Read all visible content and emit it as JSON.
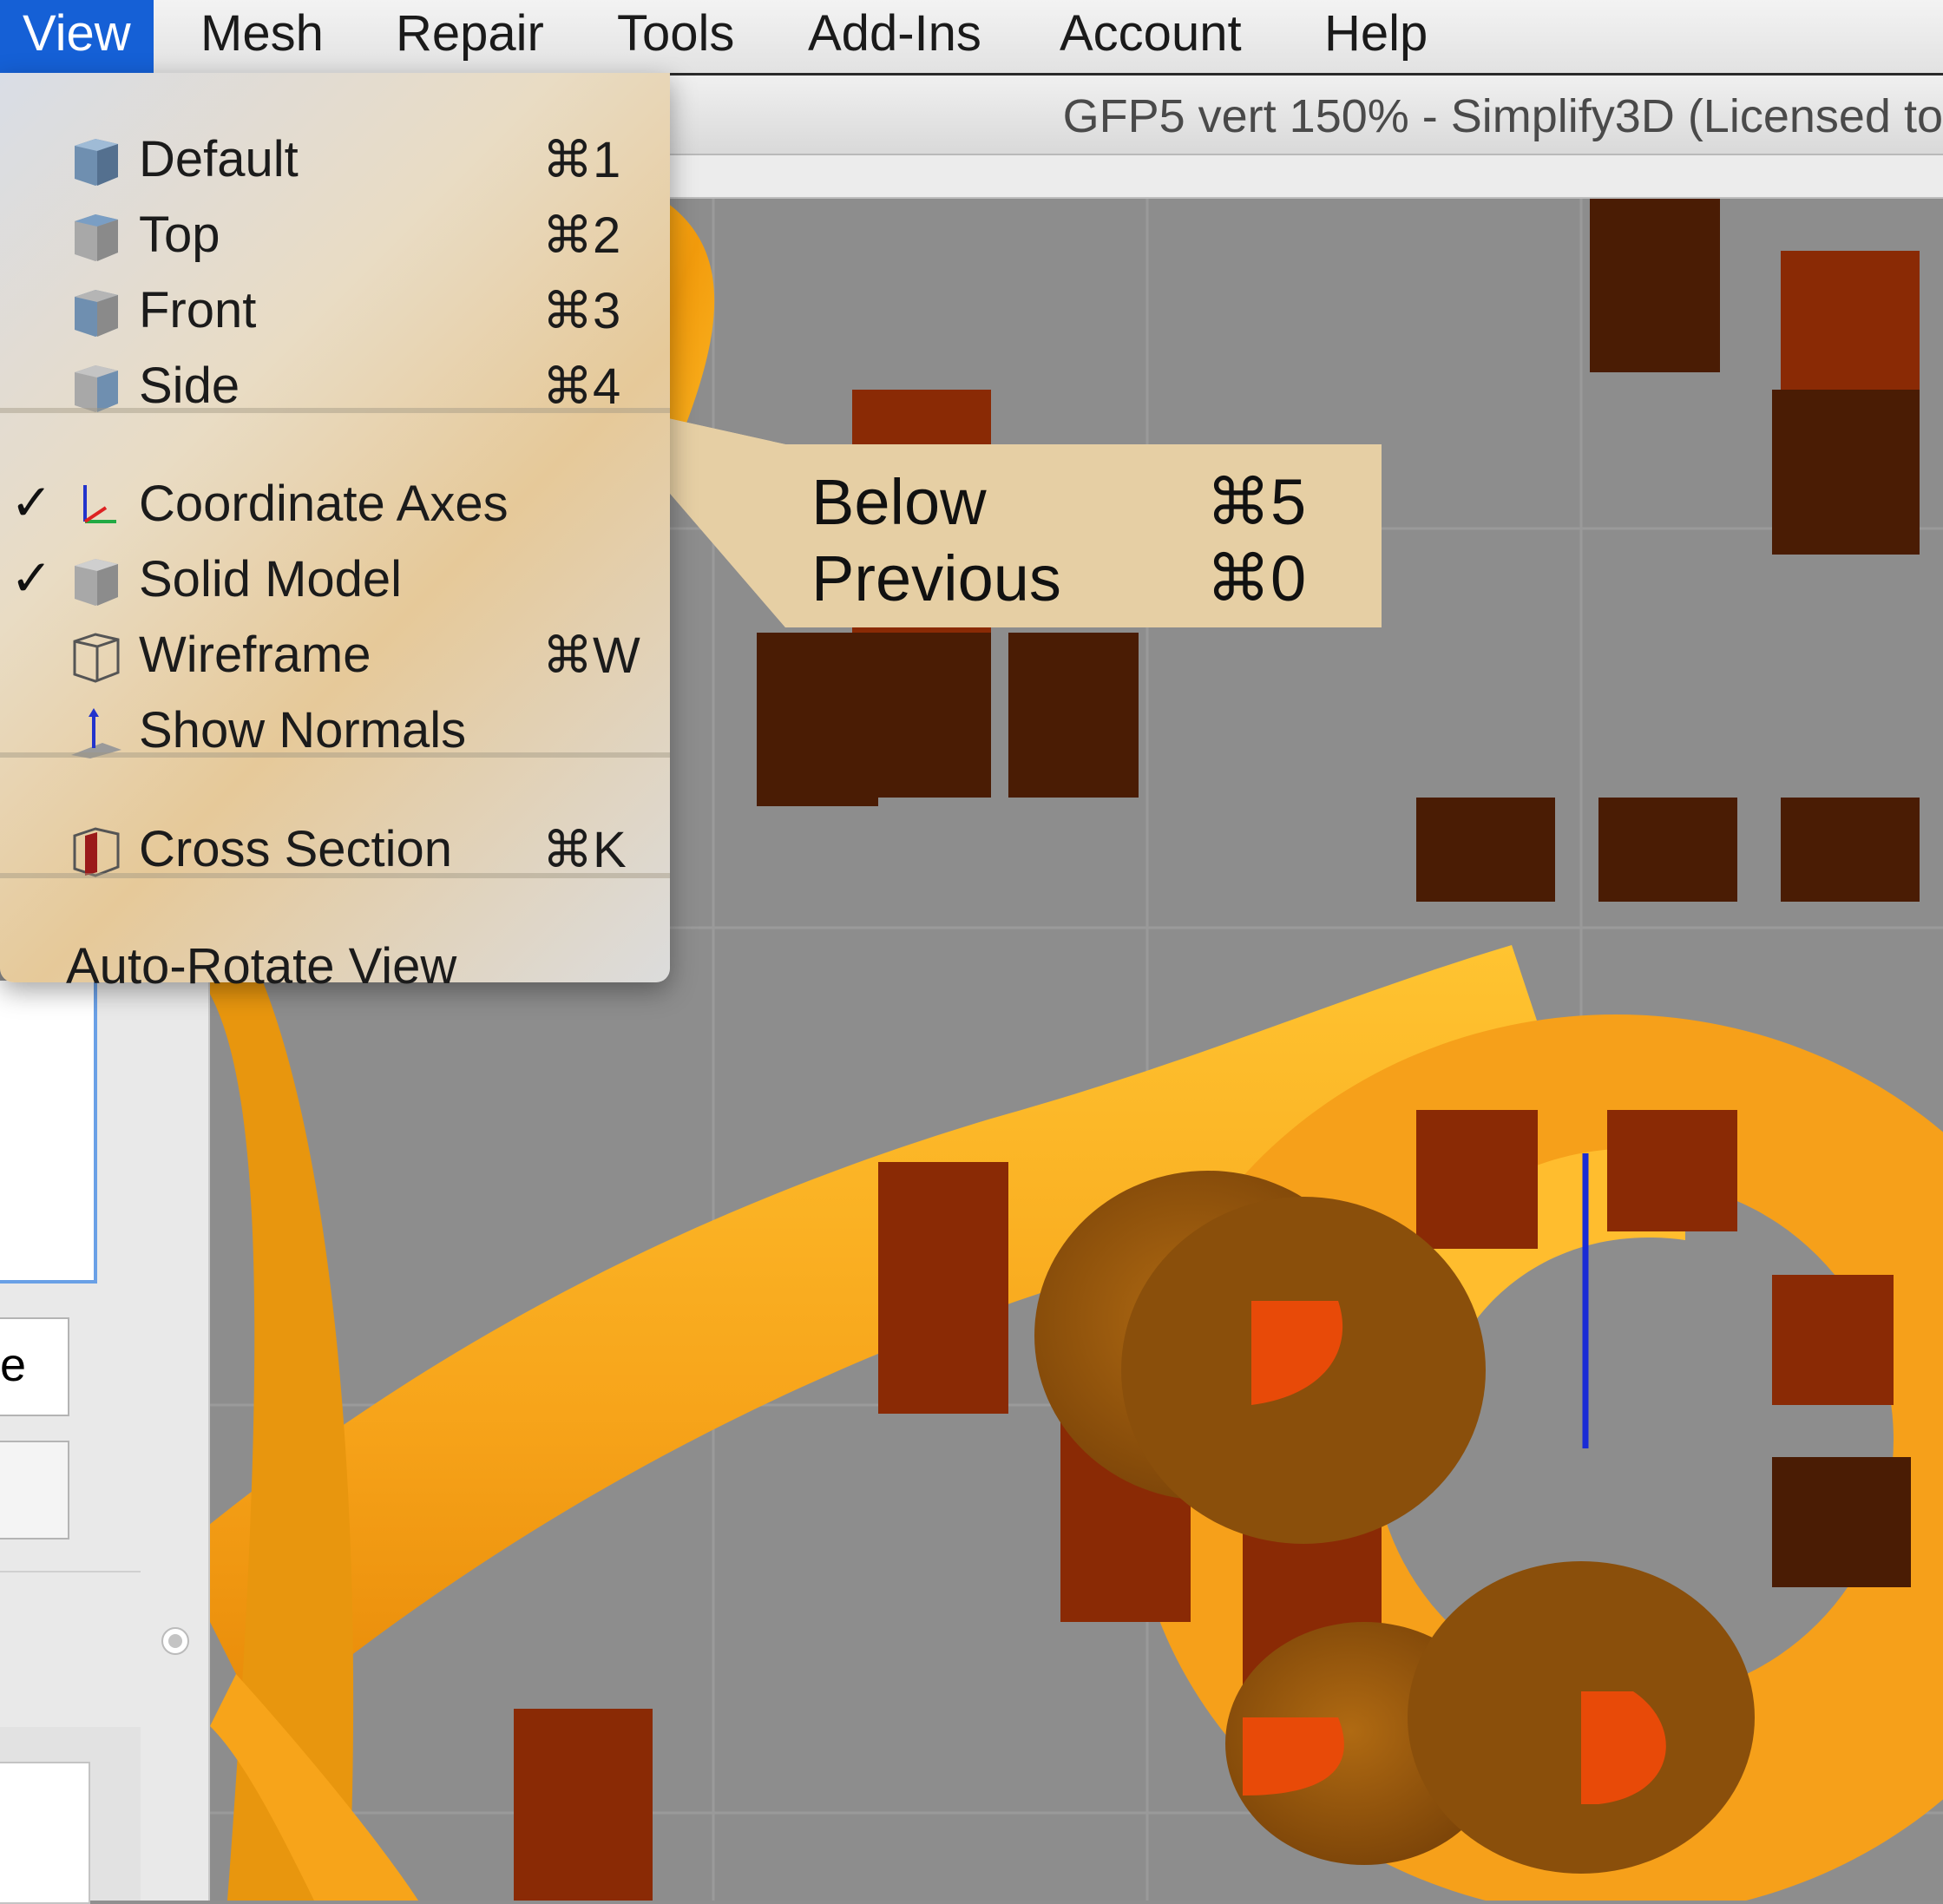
{
  "menubar": {
    "items": [
      "View",
      "Mesh",
      "Repair",
      "Tools",
      "Add-Ins",
      "Account",
      "Help"
    ],
    "active": "View"
  },
  "window": {
    "title": "GFP5 vert 150% - Simplify3D (Licensed to"
  },
  "view_menu": {
    "items": [
      {
        "label": "Default",
        "shortcut": "⌘1",
        "icon": "cube-default-icon",
        "checked": false
      },
      {
        "label": "Top",
        "shortcut": "⌘2",
        "icon": "cube-top-icon",
        "checked": false
      },
      {
        "label": "Front",
        "shortcut": "⌘3",
        "icon": "cube-front-icon",
        "checked": false
      },
      {
        "label": "Side",
        "shortcut": "⌘4",
        "icon": "cube-side-icon",
        "checked": false
      },
      {
        "label": "Coordinate Axes",
        "shortcut": "",
        "icon": "coordinate-axes-icon",
        "checked": true
      },
      {
        "label": "Solid Model",
        "shortcut": "",
        "icon": "solid-model-icon",
        "checked": true
      },
      {
        "label": "Wireframe",
        "shortcut": "⌘W",
        "icon": "wireframe-icon",
        "checked": false
      },
      {
        "label": "Show Normals",
        "shortcut": "",
        "icon": "normals-icon",
        "checked": false
      },
      {
        "label": "Cross Section",
        "shortcut": "⌘K",
        "icon": "cross-section-icon",
        "checked": false
      },
      {
        "label": "Auto-Rotate View",
        "shortcut": "",
        "icon": "",
        "checked": false
      }
    ],
    "check_glyph": "✓"
  },
  "callout": {
    "rows": [
      {
        "label": "Below",
        "shortcut": "⌘5"
      },
      {
        "label": "Previous",
        "shortcut": "⌘0"
      }
    ]
  },
  "left_panel": {
    "button_text_fragment": "e"
  },
  "colors": {
    "menu_highlight": "#1560d6",
    "model_orange": "#f7a41a",
    "model_dark": "#4a1c04",
    "model_red": "#8a2a05",
    "grid_bg": "#8d8d8d",
    "callout_bg": "#e6cfa4",
    "normal_line": "#1a2bd6"
  }
}
